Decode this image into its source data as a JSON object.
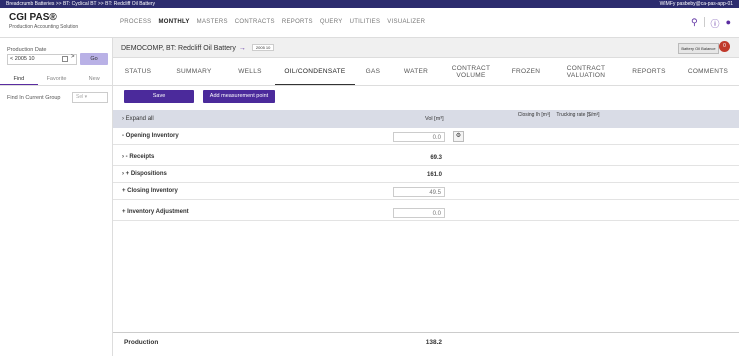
{
  "topbar": {
    "breadcrumb": "Breadcrumb   Batteries >> BT: Cyclical BT >> BT: Redcliff Oil Battery",
    "user": "WIMFy pasbeby@ca-pas-app-01"
  },
  "header": {
    "logo": "CGI PAS®",
    "logo_sub": "Production Accounting Solution",
    "nav": [
      "PROCESS",
      "MONTHLY",
      "MASTERS",
      "CONTRACTS",
      "REPORTS",
      "QUERY",
      "UTILITIES",
      "VISUALIZER"
    ],
    "active_nav": "MONTHLY"
  },
  "sidebar": {
    "prod_date_label": "Production Date",
    "prod_date_value": "< 2005 10",
    "next_symbol": ">",
    "go_label": "Go",
    "tabs": [
      "Find",
      "Favorite",
      "New"
    ],
    "find_label": "Find In Current Group",
    "find_select": "Sel"
  },
  "main": {
    "crumb_text": "DEMOCOMP,  BT: Redcliff Oil Battery",
    "crumb_arrow": "→",
    "crumb_badge": "2005 10",
    "battery_btn": "Battery Oil Balance",
    "bell_count": "0",
    "subtabs": [
      "STATUS",
      "SUMMARY",
      "WELLS",
      "OIL/CONDENSATE",
      "GAS",
      "WATER",
      "CONTRACT VOLUME",
      "FROZEN",
      "CONTRACT VALUATION",
      "REPORTS",
      "COMMENTS"
    ],
    "active_subtab": "OIL/CONDENSATE",
    "save_label": "Save",
    "add_point_label": "Add measurement point",
    "table": {
      "expand_all": "Expand all",
      "col_vol": "Vol [m³]",
      "col_closing": "Closing Ih [m³]",
      "col_trucking": "Trucking rate [$/m³]"
    },
    "rows": [
      {
        "label": "- Opening Inventory",
        "value": "0.0",
        "boxed": true,
        "gear": true
      },
      {
        "label": "- Receipts",
        "value": "69.3",
        "boxed": false,
        "expander": true
      },
      {
        "label": "+ Dispositions",
        "value": "161.0",
        "boxed": false,
        "expander": true
      },
      {
        "label": "+ Closing Inventory",
        "value": "49.5",
        "boxed": true
      },
      {
        "label": "+ Inventory Adjustment",
        "value": "0.0",
        "boxed": true
      }
    ],
    "footer_label": "Production",
    "footer_value": "138.2"
  },
  "colors": {
    "primary": "#4b2a9b",
    "topbar": "#2c2c6e",
    "header_row": "#d9dce6",
    "accent_red": "#e31937"
  }
}
